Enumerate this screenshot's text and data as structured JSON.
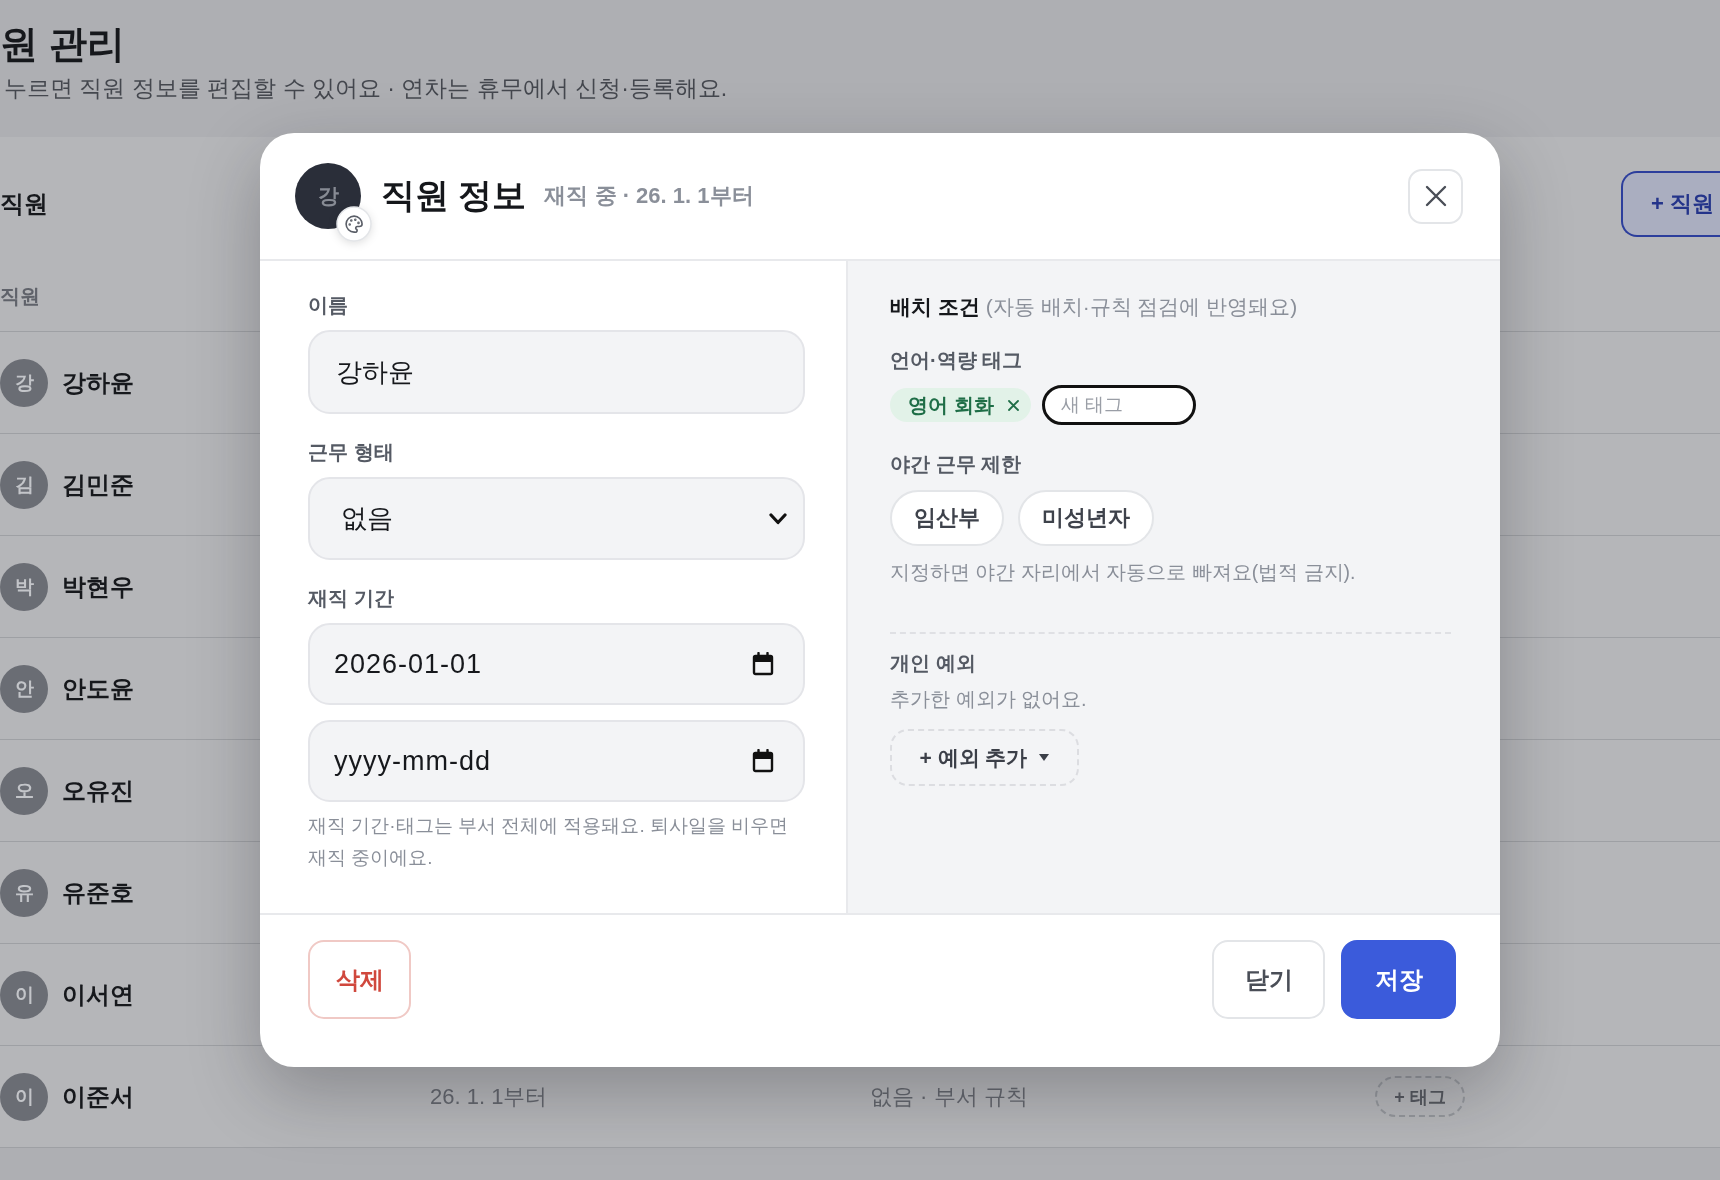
{
  "page": {
    "title": "원 관리",
    "subtitle": "누르면 직원 정보를 편집할 수 있어요 · 연차는 휴무에서 신청·등록해요.",
    "staff_card": {
      "title": "직원",
      "add_button": "+ 직원",
      "columns": [
        "직원"
      ],
      "rows": [
        {
          "initial": "강",
          "name": "강하윤"
        },
        {
          "initial": "김",
          "name": "김민준"
        },
        {
          "initial": "박",
          "name": "박현우"
        },
        {
          "initial": "안",
          "name": "안도윤"
        },
        {
          "initial": "오",
          "name": "오유진"
        },
        {
          "initial": "유",
          "name": "유준호"
        },
        {
          "initial": "이",
          "name": "이서연"
        },
        {
          "initial": "이",
          "name": "이준서",
          "period": "26. 1. 1부터",
          "rule": "없음 · 부서 규칙",
          "tag_button": "+ 태그"
        }
      ]
    }
  },
  "dialog": {
    "avatar_initial": "강",
    "title": "직원 정보",
    "status": "재직 중 · 26. 1. 1부터",
    "form": [
      {
        "kind": "text",
        "label": "이름",
        "value": "강하윤"
      },
      {
        "kind": "select",
        "label": "근무 형태",
        "value": "없음"
      },
      {
        "kind": "date_range",
        "label": "재직 기간",
        "start": {
          "value": "2026-01-01"
        },
        "end": {
          "placeholder": "yyyy-mm-dd"
        },
        "hint": "재직 기간·태그는 부서 전체에 적용돼요. 퇴사일을 비우면 재직 중이에요."
      }
    ],
    "placement": {
      "title": "배치 조건",
      "note": "(자동 배치·규칙 점검에 반영돼요)",
      "tags": {
        "label": "언어·역량 태그",
        "items": [
          {
            "text": "영어 회화"
          }
        ],
        "input": {
          "placeholder": "새 태그",
          "focused": true
        }
      },
      "night_limit": {
        "label": "야간 근무 제한",
        "options": [
          {
            "label": "임산부",
            "selected": false
          },
          {
            "label": "미성년자",
            "selected": false
          }
        ],
        "hint": "지정하면 야간 자리에서 자동으로 빠져요(법적 금지)."
      }
    },
    "exceptions": {
      "title": "개인 예외",
      "empty_text": "추가한 예외가 없어요.",
      "add_button": "+ 예외 추가"
    },
    "buttons": [
      {
        "kind": "danger",
        "label": "삭제"
      },
      {
        "kind": "secondary",
        "label": "닫기"
      },
      {
        "kind": "primary",
        "label": "저장"
      }
    ]
  }
}
